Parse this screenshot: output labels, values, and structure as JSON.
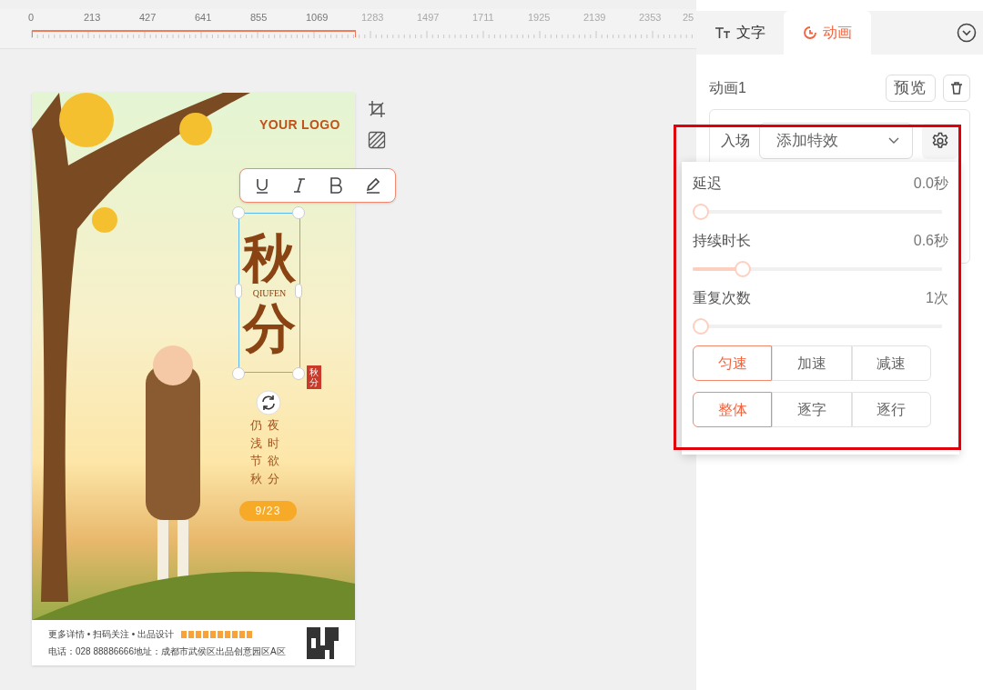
{
  "ruler": {
    "labels": [
      {
        "text": "0",
        "in_page": true
      },
      {
        "text": "213",
        "in_page": true
      },
      {
        "text": "427",
        "in_page": true
      },
      {
        "text": "641",
        "in_page": true
      },
      {
        "text": "855",
        "in_page": true
      },
      {
        "text": "1069",
        "in_page": true
      },
      {
        "text": "1283",
        "in_page": false
      },
      {
        "text": "1497",
        "in_page": false
      },
      {
        "text": "1711",
        "in_page": false
      },
      {
        "text": "1925",
        "in_page": false
      },
      {
        "text": "2139",
        "in_page": false
      },
      {
        "text": "2353",
        "in_page": false
      },
      {
        "text": "25",
        "in_page": false
      }
    ]
  },
  "poster": {
    "logo": "YOUR LOGO",
    "title_top": "秋",
    "title_pinyin": "QIUFEN",
    "title_bottom": "分",
    "seal": "秋分",
    "poem_columns": [
      "仍浅节秋",
      "夜时欲分"
    ],
    "date": "9/23",
    "footer_line_1": "更多详情 • 扫码关注 • 出品设计",
    "footer_line_2": "电话：028 88886666地址：成都市武侯区出品创意园区A区"
  },
  "text_toolbar": [
    {
      "kind": "underline"
    },
    {
      "kind": "italic"
    },
    {
      "kind": "bold"
    },
    {
      "kind": "pen"
    }
  ],
  "panel": {
    "tabs": [
      {
        "label": "文字",
        "kind": "text",
        "selected": false
      },
      {
        "label": "动画",
        "kind": "clock",
        "selected": true
      }
    ],
    "animation_name": "动画1",
    "preview_button": "预览",
    "entry_label": "入场",
    "effect_select": "添加特效",
    "settings": {
      "sliders": [
        {
          "label": "延迟",
          "reading": "0.0秒",
          "level": 0
        },
        {
          "label": "持续时长",
          "reading": "0.6秒",
          "level": 0.2
        },
        {
          "label": "重复次数",
          "reading": "1次",
          "level": 0
        }
      ],
      "speed_options": [
        {
          "label": "匀速",
          "selected": true
        },
        {
          "label": "加速",
          "selected": false
        },
        {
          "label": "减速",
          "selected": false
        }
      ],
      "mode_options": [
        {
          "label": "整体",
          "selected": true
        },
        {
          "label": "逐字",
          "selected": false
        },
        {
          "label": "逐行",
          "selected": false
        }
      ]
    }
  }
}
